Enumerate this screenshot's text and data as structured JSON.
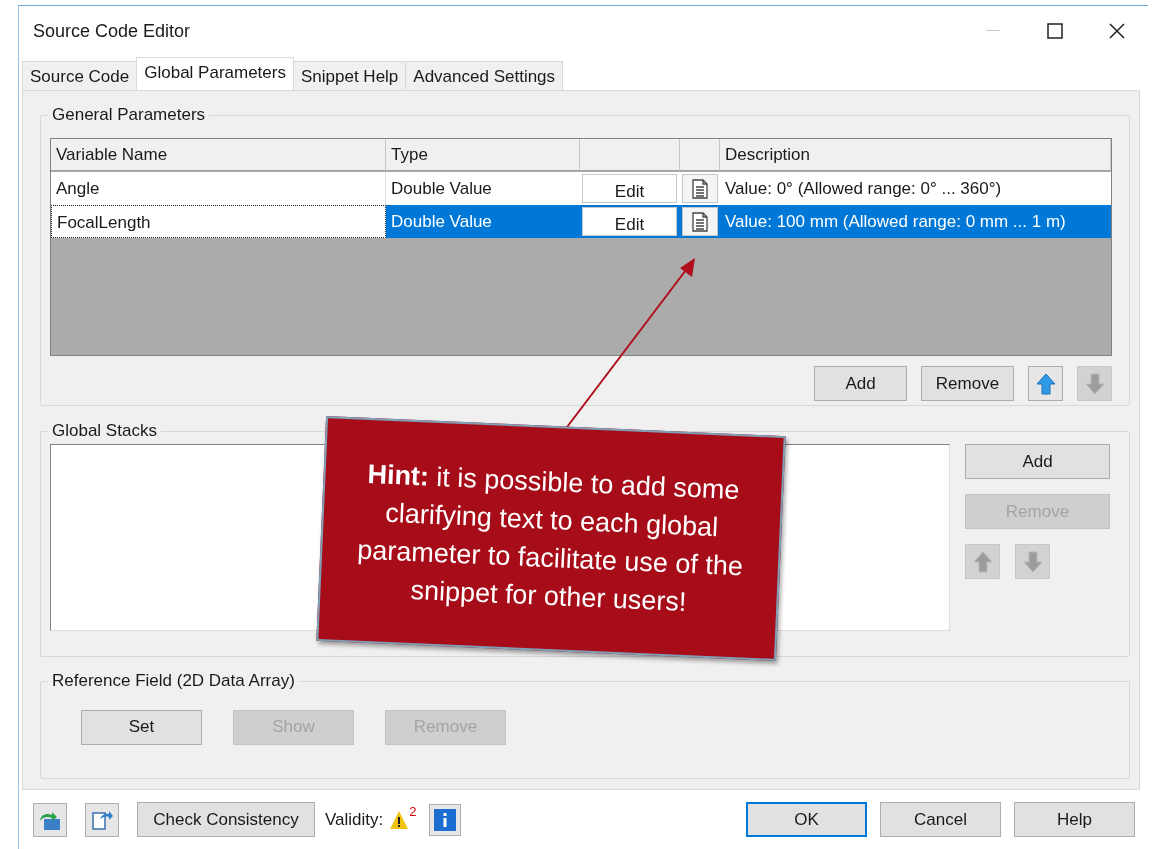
{
  "window": {
    "title": "Source Code Editor"
  },
  "tabs": [
    {
      "label": "Source Code",
      "selected": false
    },
    {
      "label": "Global Parameters",
      "selected": true
    },
    {
      "label": "Snippet Help",
      "selected": false
    },
    {
      "label": "Advanced Settings",
      "selected": false
    }
  ],
  "general_parameters": {
    "title": "General Parameters",
    "columns": [
      "Variable Name",
      "Type",
      "Description"
    ],
    "rows": [
      {
        "name": "Angle",
        "type": "Double Value",
        "edit": "Edit",
        "description": "Value: 0° (Allowed range: 0° ... 360°)",
        "selected": false
      },
      {
        "name": "FocalLength",
        "type": "Double Value",
        "edit": "Edit",
        "description": "Value: 100 mm (Allowed range: 0 mm ... 1 m)",
        "selected": true
      }
    ],
    "buttons": [
      {
        "kind": "text",
        "label": "Add",
        "disabled": false
      },
      {
        "kind": "text",
        "label": "Remove",
        "disabled": false
      },
      {
        "kind": "up",
        "disabled": false
      },
      {
        "kind": "down",
        "disabled": true
      }
    ]
  },
  "global_stacks": {
    "title": "Global Stacks",
    "buttons": [
      {
        "kind": "text",
        "label": "Add",
        "disabled": false
      },
      {
        "kind": "text",
        "label": "Remove",
        "disabled": true
      },
      {
        "kind": "up",
        "disabled": true
      },
      {
        "kind": "down",
        "disabled": true
      }
    ]
  },
  "reference_field": {
    "title": "Reference Field (2D Data Array)",
    "buttons": [
      {
        "kind": "text",
        "label": "Set",
        "disabled": false
      },
      {
        "kind": "text",
        "label": "Show",
        "disabled": true
      },
      {
        "kind": "text",
        "label": "Remove",
        "disabled": true
      }
    ]
  },
  "footer": {
    "check_button": "Check Consistency",
    "validity_label": "Validity:",
    "warning_count": "2",
    "buttons": [
      {
        "label": "OK",
        "default": true
      },
      {
        "label": "Cancel",
        "default": false
      },
      {
        "label": "Help",
        "default": false
      }
    ]
  },
  "hint": {
    "text": "**Hint:** it is possible to add some clarifying text to each global parameter to facilitate use of the snippet for other users!"
  }
}
